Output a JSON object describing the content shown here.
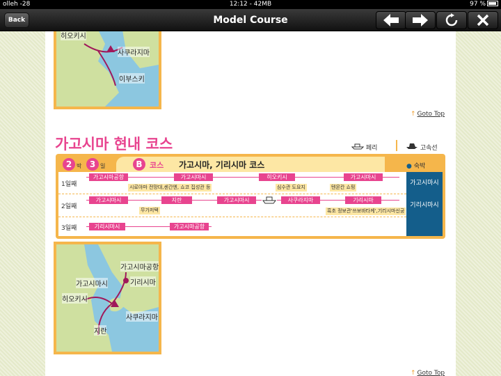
{
  "status_bar": {
    "carrier": "olleh -28",
    "time": "12:12 - 42MB",
    "battery": "97 %"
  },
  "navbar": {
    "back_label": "Back",
    "title": "Model Course",
    "prev_icon": "left-arrow-icon",
    "next_icon": "right-arrow-icon",
    "reload_icon": "reload-icon",
    "close_icon": "close-icon"
  },
  "top_map": {
    "labels": [
      "히오키시",
      "사쿠라지마",
      "이부스키"
    ]
  },
  "goto_top_label": "Goto Top",
  "section": {
    "title": "가고시마 현내 코스",
    "legend_ferry": "페리",
    "legend_highspeed": "고속선"
  },
  "course": {
    "nights": "2",
    "nights_unit": "박",
    "days": "3",
    "days_unit": "일",
    "badge": "B",
    "badge_label": "코스",
    "name": "가고시마, 기리시마 코스",
    "stay_label": "숙박",
    "rows": [
      {
        "day": "1일째",
        "stops": [
          "가고시마공항",
          "가고시마시",
          "히오키시",
          "가고시마시"
        ],
        "notes": [
          "시로야마 전망대,센간엔, 쇼코 집성관 등",
          "심수관 도요지",
          "텐몬칸 쇼핑"
        ],
        "stay": "가고시마시"
      },
      {
        "day": "2일째",
        "stops": [
          "가고시마시",
          "지란",
          "가고시마시",
          "사쿠라지마",
          "기리시마"
        ],
        "notes": [
          "무가저택",
          "흑초 정보관'쓰보바타케',기리시마신궁"
        ],
        "stay": "기리시마시"
      },
      {
        "day": "3일째",
        "stops": [
          "기리시마시",
          "가고시마공항"
        ],
        "notes": [],
        "stay": ""
      }
    ]
  },
  "bottom_map": {
    "labels": [
      "가고시마공항",
      "가고시마시",
      "기리시마",
      "히오키시",
      "사쿠라지마",
      "지란"
    ]
  },
  "colors": {
    "accent_pink": "#e8448f",
    "frame_orange": "#f5b64b",
    "stay_blue": "#145e8b"
  }
}
